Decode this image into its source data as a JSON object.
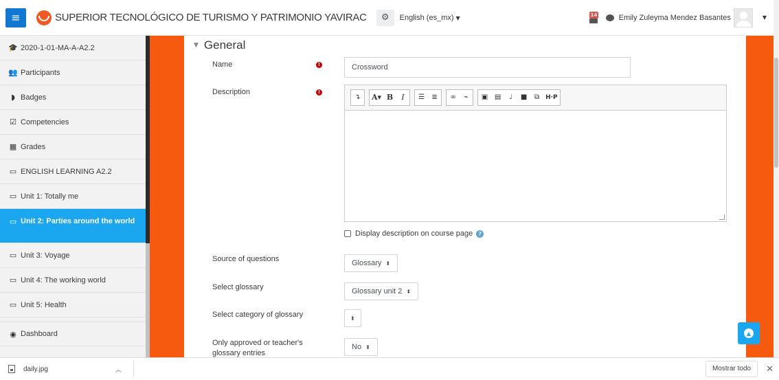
{
  "navbar": {
    "menu_icon": "hamburger-icon",
    "site_name": "SUPERIOR TECNOLÓGICO DE TURISMO Y PATRIMONIO YAVIRAC",
    "settings_icon": "gears-icon",
    "language": "English (es_mx)",
    "notification_count": "14",
    "user_name": "Emily Zuleyma Mendez Basantes"
  },
  "drawer": {
    "items": [
      {
        "icon": "graduation-cap-icon",
        "label": "2020-1-01-MA-A-A2.2"
      },
      {
        "icon": "users-icon",
        "label": "Participants"
      },
      {
        "icon": "shield-icon",
        "label": "Badges"
      },
      {
        "icon": "checkbox-icon",
        "label": "Competencies"
      },
      {
        "icon": "table-icon",
        "label": "Grades"
      },
      {
        "icon": "folder-icon",
        "label": "ENGLISH LEARNING A2.2"
      },
      {
        "icon": "folder-icon",
        "label": "Unit 1: Totally me"
      },
      {
        "icon": "folder-icon",
        "label": "Unit 2: Parties around the world"
      },
      {
        "icon": "folder-icon",
        "label": "Unit 3: Voyage"
      },
      {
        "icon": "folder-icon",
        "label": "Unit 4: The working world"
      },
      {
        "icon": "folder-icon",
        "label": "Unit 5: Health"
      },
      {
        "icon": "dashboard-icon",
        "label": "Dashboard"
      }
    ],
    "active_index": 7
  },
  "form": {
    "section_title": "General",
    "name_label": "Name",
    "name_value": "Crossword",
    "description_label": "Description",
    "display_description_label": "Display description on course page",
    "source_label": "Source of questions",
    "source_value": "Glossary",
    "glossary_label": "Select glossary",
    "glossary_value": "Glossary unit 2",
    "category_label": "Select category of glossary",
    "category_value": "",
    "approved_label": "Only approved or teacher's glossary entries",
    "approved_value": "No"
  },
  "downloads": {
    "file_name": "daily.jpg",
    "show_all": "Mostrar todo"
  }
}
